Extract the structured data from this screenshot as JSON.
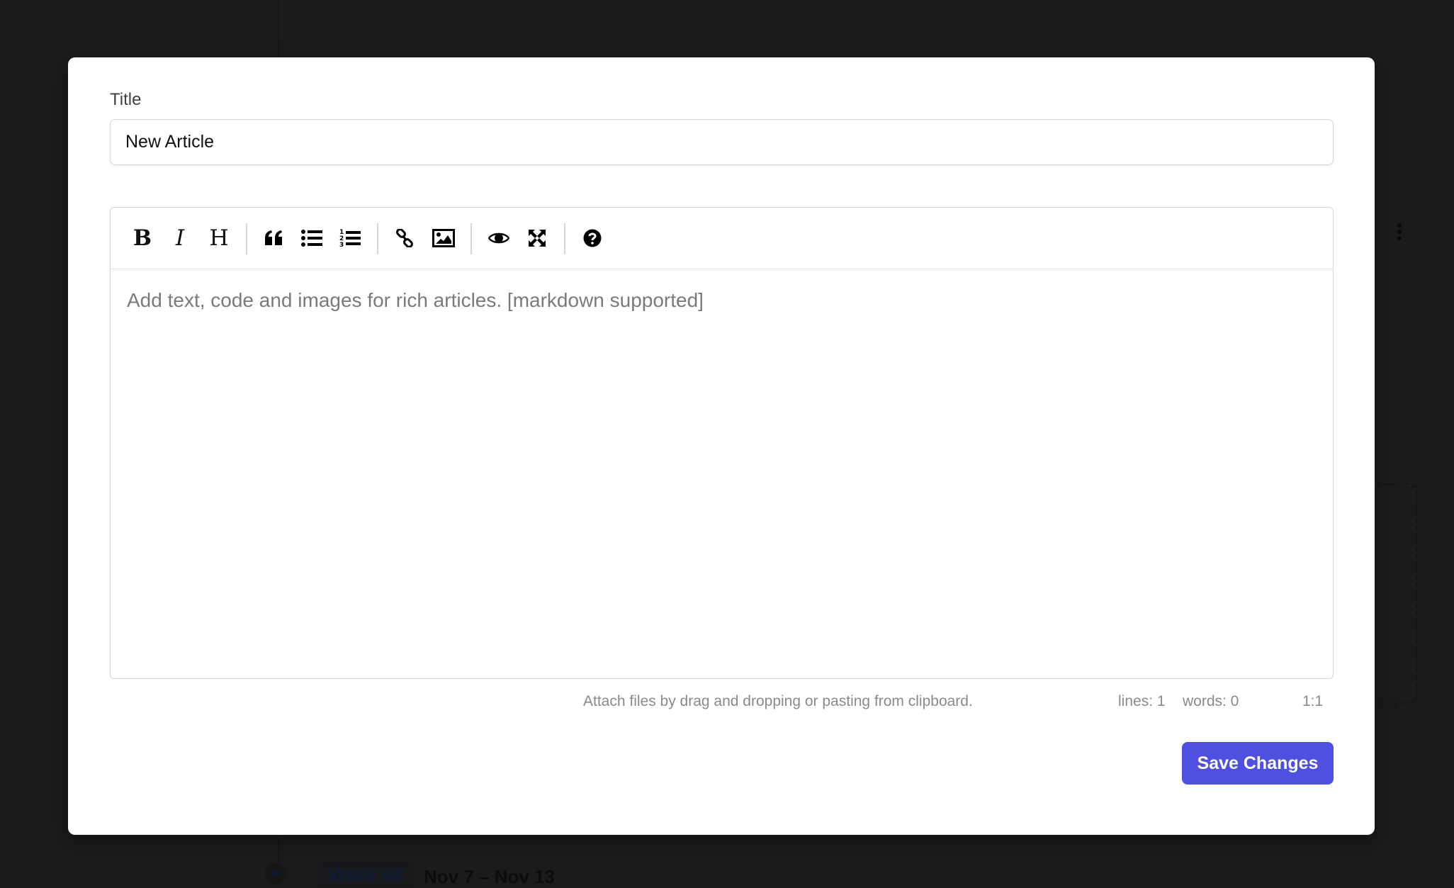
{
  "background": {
    "week_badge": "Week 46",
    "week_range": "Nov 7 – Nov 13"
  },
  "modal": {
    "title_label": "Title",
    "title_value": "New Article",
    "editor": {
      "toolbar": [
        {
          "name": "bold",
          "icon": "bold-icon",
          "glyph": "B"
        },
        {
          "name": "italic",
          "icon": "italic-icon",
          "glyph": "I"
        },
        {
          "name": "heading",
          "icon": "heading-icon",
          "glyph": "H"
        },
        {
          "name": "quote",
          "icon": "quote-icon"
        },
        {
          "name": "unordered-list",
          "icon": "unordered-list-icon"
        },
        {
          "name": "ordered-list",
          "icon": "ordered-list-icon"
        },
        {
          "name": "link",
          "icon": "link-icon"
        },
        {
          "name": "image",
          "icon": "image-icon"
        },
        {
          "name": "preview",
          "icon": "eye-icon"
        },
        {
          "name": "fullscreen",
          "icon": "fullscreen-icon"
        },
        {
          "name": "guide",
          "icon": "help-icon"
        }
      ],
      "placeholder": "Add text, code and images for rich articles. [markdown supported]"
    },
    "statusbar": {
      "attach_hint": "Attach files by drag and dropping or pasting from clipboard.",
      "lines": "lines: 1",
      "words": "words: 0",
      "cursor": "1:1"
    },
    "save_label": "Save Changes",
    "accent_color": "#4f4fe0"
  }
}
